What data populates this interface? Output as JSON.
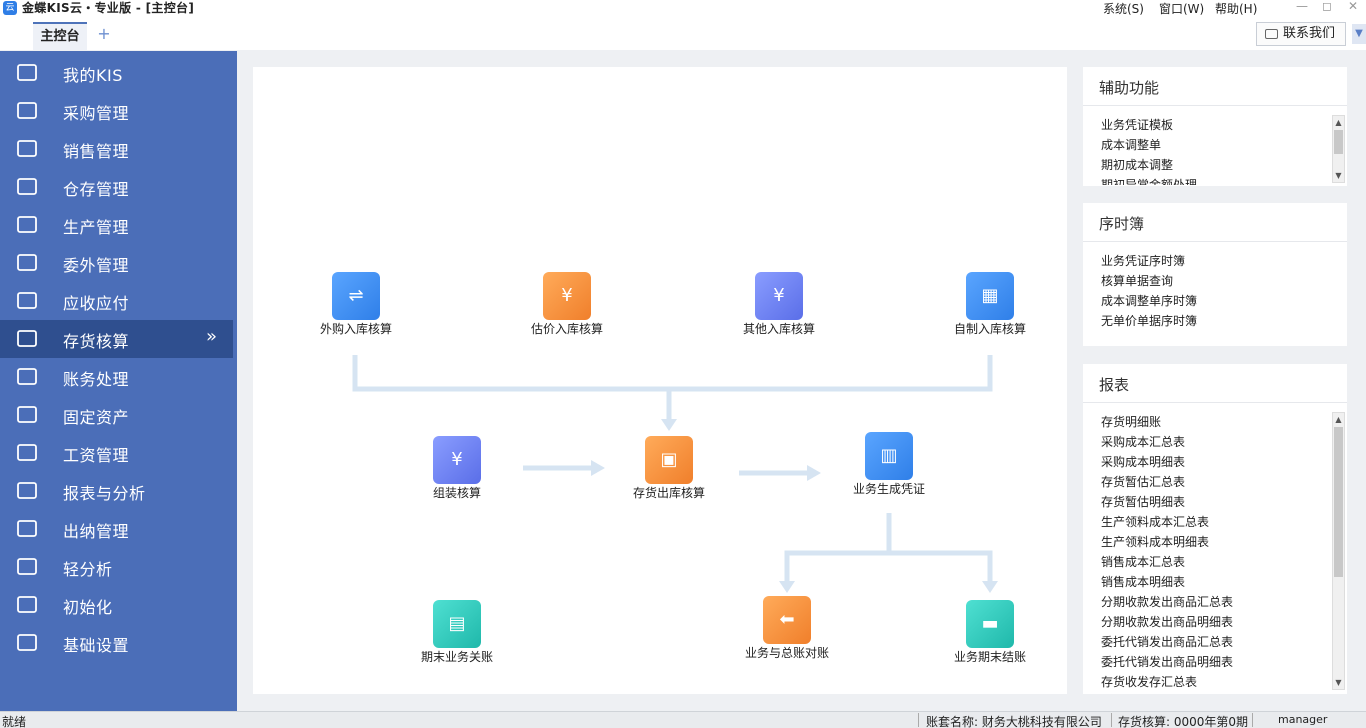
{
  "window": {
    "title": "金蝶KIS云・专业版 - [主控台]",
    "menus": [
      "系统(S)",
      "窗口(W)",
      "帮助(H)"
    ],
    "controls": [
      "—",
      "◻",
      "✕"
    ]
  },
  "tabs": {
    "active": "主控台",
    "add_icon": "+"
  },
  "contact_button": "联系我们",
  "sidebar": {
    "items": [
      {
        "label": "我的KIS",
        "icon": "monitor-icon"
      },
      {
        "label": "采购管理",
        "icon": "bag-icon"
      },
      {
        "label": "销售管理",
        "icon": "users-icon"
      },
      {
        "label": "仓存管理",
        "icon": "house-icon"
      },
      {
        "label": "生产管理",
        "icon": "hexagon-icon"
      },
      {
        "label": "委外管理",
        "icon": "people-group-icon"
      },
      {
        "label": "应收应付",
        "icon": "yen-box-icon"
      },
      {
        "label": "存货核算",
        "icon": "search-doc-icon"
      },
      {
        "label": "账务处理",
        "icon": "ledger-icon"
      },
      {
        "label": "固定资产",
        "icon": "building-icon"
      },
      {
        "label": "工资管理",
        "icon": "salary-icon"
      },
      {
        "label": "报表与分析",
        "icon": "chart-icon"
      },
      {
        "label": "出纳管理",
        "icon": "cash-icon"
      },
      {
        "label": "轻分析",
        "icon": "magnifier-icon"
      },
      {
        "label": "初始化",
        "icon": "target-icon"
      },
      {
        "label": "基础设置",
        "icon": "gear-icon"
      }
    ],
    "active_index": 7,
    "active_chevron": "»"
  },
  "flow": {
    "nodes": [
      {
        "label": "外购入库核算",
        "icon": "exchange-icon",
        "glyph": "⇌"
      },
      {
        "label": "估价入库核算",
        "icon": "estimate-chart-icon",
        "glyph": "¥"
      },
      {
        "label": "其他入库核算",
        "icon": "yen-doc-icon",
        "glyph": "¥"
      },
      {
        "label": "自制入库核算",
        "icon": "calculator-icon",
        "glyph": "▦"
      },
      {
        "label": "组装核算",
        "icon": "assembly-icon",
        "glyph": "¥"
      },
      {
        "label": "存货出库核算",
        "icon": "boxes-icon",
        "glyph": "▣"
      },
      {
        "label": "业务生成凭证",
        "icon": "voucher-icon",
        "glyph": "▥"
      },
      {
        "label": "期末业务关账",
        "icon": "notebook-icon",
        "glyph": "▤"
      },
      {
        "label": "业务与总账对账",
        "icon": "reconcile-icon",
        "glyph": "⬅"
      },
      {
        "label": "业务期末结账",
        "icon": "printer-icon",
        "glyph": "▬"
      }
    ]
  },
  "panels": {
    "aux": {
      "title": "辅助功能",
      "items": [
        "业务凭证模板",
        "成本调整单",
        "期初成本调整",
        "期初异常金额处理"
      ]
    },
    "journal": {
      "title": "序时簿",
      "items": [
        "业务凭证序时簿",
        "核算单据查询",
        "成本调整单序时簿",
        "无单价单据序时簿"
      ]
    },
    "reports": {
      "title": "报表",
      "items": [
        "存货明细账",
        "采购成本汇总表",
        "采购成本明细表",
        "存货暂估汇总表",
        "存货暂估明细表",
        "生产领料成本汇总表",
        "生产领料成本明细表",
        "销售成本汇总表",
        "销售成本明细表",
        "分期收款发出商品汇总表",
        "分期收款发出商品明细表",
        "委托代销发出商品汇总表",
        "委托代销发出商品明细表",
        "存货收发存汇总表"
      ]
    }
  },
  "statusbar": {
    "status": "就绪",
    "account": "账套名称: 财务大桃科技有限公司",
    "period": "存货核算: 0000年第0期",
    "user": "manager"
  },
  "colors": {
    "sidebar": "#4b6eb8",
    "sidebar_active": "#2f4f8f",
    "flow_line": "#d6e4f2",
    "accent_blue": "#2f7fe8",
    "accent_orange": "#f07f2b",
    "accent_teal": "#1fb8aa"
  }
}
